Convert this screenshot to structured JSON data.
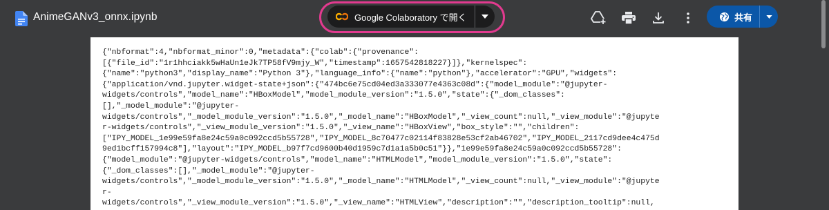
{
  "file": {
    "name": "AnimeGANv3_onnx.ipynb",
    "icon": "document-icon",
    "icon_color": "#4285f4"
  },
  "open_with": {
    "label": "Google Colaboratory で開く",
    "logo": "colab-logo",
    "highlight_color": "#e23a8f"
  },
  "toolbar": {
    "icons": [
      "add-to-drive-icon",
      "print-icon",
      "download-icon",
      "more-vert-icon"
    ]
  },
  "share": {
    "label": "共有",
    "icon": "globe-icon",
    "color": "#0b57a8"
  },
  "document": {
    "lines": [
      "{\"nbformat\":4,\"nbformat_minor\":0,\"metadata\":{\"colab\":{\"provenance\":",
      "[{\"file_id\":\"1r1hhciakk5wHaUn1eJk7TP58fV9mjy_W\",\"timestamp\":1657542818227}]},\"kernelspec\":",
      "{\"name\":\"python3\",\"display_name\":\"Python 3\"},\"language_info\":{\"name\":\"python\"},\"accelerator\":\"GPU\",\"widgets\":",
      "{\"application/vnd.jupyter.widget-state+json\":{\"474bc6e75cd04ed3a333077e4363c08d\":{\"model_module\":\"@jupyter-",
      "widgets/controls\",\"model_name\":\"HBoxModel\",\"model_module_version\":\"1.5.0\",\"state\":{\"_dom_classes\":",
      "[],\"_model_module\":\"@jupyter-",
      "widgets/controls\",\"_model_module_version\":\"1.5.0\",\"_model_name\":\"HBoxModel\",\"_view_count\":null,\"_view_module\":\"@jupyte",
      "r-widgets/controls\",\"_view_module_version\":\"1.5.0\",\"_view_name\":\"HBoxView\",\"box_style\":\"\",\"children\":",
      "[\"IPY_MODEL_1e99e59fa8e24c59a0c092ccd5b55728\",\"IPY_MODEL_8c70477c02114f83828e53cf2ab46702\",\"IPY_MODEL_2117cd9dee4c475d",
      "9ed1bcff157994c8\"],\"layout\":\"IPY_MODEL_b97f7cd9600b40d1959c7d1a1a5b0c51\"}},\"1e99e59fa8e24c59a0c092ccd5b55728\":",
      "{\"model_module\":\"@jupyter-widgets/controls\",\"model_name\":\"HTMLModel\",\"model_module_version\":\"1.5.0\",\"state\":",
      "{\"_dom_classes\":[],\"_model_module\":\"@jupyter-",
      "widgets/controls\",\"_model_module_version\":\"1.5.0\",\"_model_name\":\"HTMLModel\",\"_view_count\":null,\"_view_module\":\"@jupyte",
      "r-",
      "widgets/controls\",\"_view_module_version\":\"1.5.0\",\"_view_name\":\"HTMLView\",\"description\":\"\",\"description_tooltip\":null,"
    ]
  }
}
